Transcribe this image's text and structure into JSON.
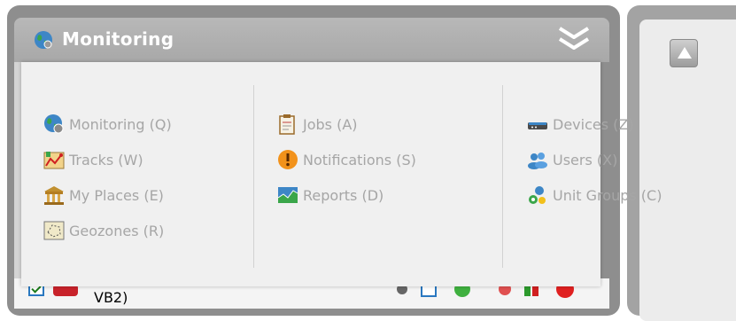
{
  "header": {
    "title": "Monitoring"
  },
  "menu": {
    "columns": [
      {
        "items": [
          {
            "label": "Monitoring (Q)",
            "icon": "globe-icon"
          },
          {
            "label": "Tracks (W)",
            "icon": "map-route-icon"
          },
          {
            "label": "My Places (E)",
            "icon": "building-icon"
          },
          {
            "label": "Geozones (R)",
            "icon": "geozone-icon"
          }
        ]
      },
      {
        "items": [
          {
            "label": "Jobs (A)",
            "icon": "clipboard-icon"
          },
          {
            "label": "Notifications (S)",
            "icon": "warning-icon"
          },
          {
            "label": "Reports (D)",
            "icon": "chart-icon"
          }
        ]
      },
      {
        "items": [
          {
            "label": "Devices (Z)",
            "icon": "device-icon"
          },
          {
            "label": "Users (X)",
            "icon": "users-icon"
          },
          {
            "label": "Unit Groups (C)",
            "icon": "unit-groups-icon"
          }
        ]
      }
    ]
  },
  "background_row": {
    "text": "VB2)"
  },
  "colors": {
    "panel_gray": "#8e8e8e",
    "header_gray": "#a8a8a8",
    "menu_text": "#a6a6a6",
    "dropdown_bg": "#f0f0f0"
  }
}
